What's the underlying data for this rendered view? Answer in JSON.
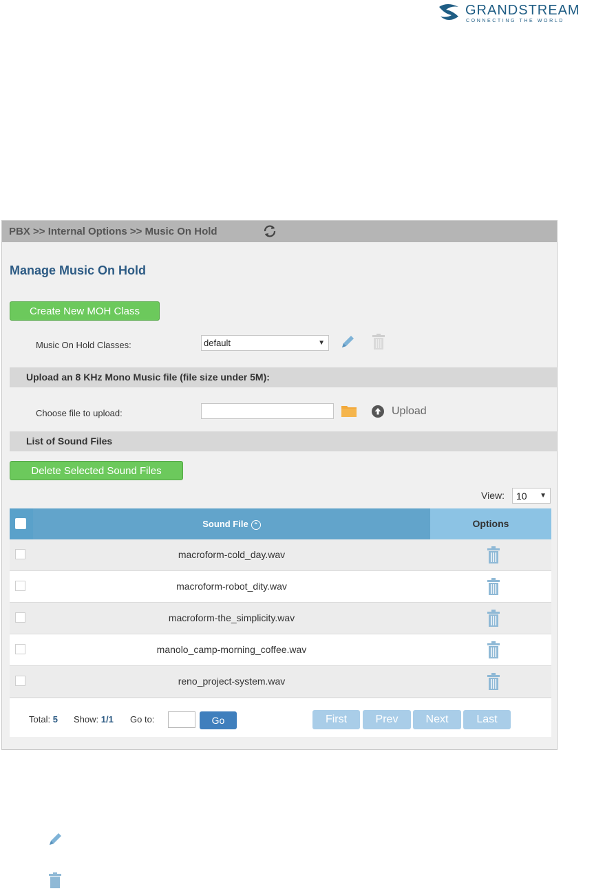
{
  "logo": {
    "name": "GRANDSTREAM",
    "tagline": "CONNECTING THE WORLD",
    "accent": "#1f5d84"
  },
  "breadcrumb": "PBX >> Internal Options >> Music On Hold",
  "page_title": "Manage Music On Hold",
  "create_button": "Create New MOH Class",
  "moh_classes": {
    "label": "Music On Hold Classes:",
    "selected": "default"
  },
  "upload_section": {
    "title": "Upload an 8 KHz Mono Music file (file size under 5M):",
    "choose_label": "Choose file to upload:",
    "upload_label": "Upload"
  },
  "list_section": {
    "title": "List of Sound Files"
  },
  "delete_button": "Delete Selected Sound Files",
  "view": {
    "label": "View:",
    "selected": "10"
  },
  "table": {
    "col_file": "Sound File",
    "col_options": "Options",
    "rows": [
      "macroform-cold_day.wav",
      "macroform-robot_dity.wav",
      "macroform-the_simplicity.wav",
      "manolo_camp-morning_coffee.wav",
      "reno_project-system.wav"
    ]
  },
  "pagination": {
    "total_label": "Total:",
    "total": "5",
    "show_label": "Show:",
    "show": "1/1",
    "goto_label": "Go to:",
    "go": "Go",
    "first": "First",
    "prev": "Prev",
    "next": "Next",
    "last": "Last"
  },
  "colors": {
    "button_green": "#6cc95c",
    "header_blue": "#62a4cb",
    "options_blue": "#8cc3e4",
    "pager_blue": "#a9cde8"
  }
}
